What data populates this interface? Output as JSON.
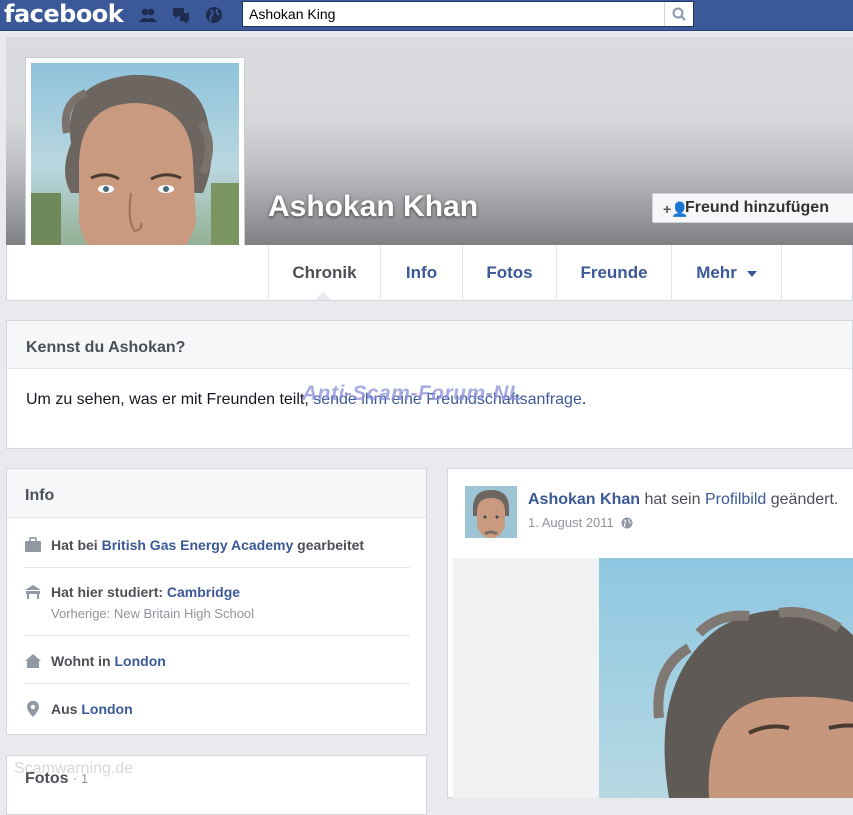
{
  "header": {
    "logo": "facebook",
    "search_value": "Ashokan King",
    "search_placeholder": ""
  },
  "profile": {
    "name": "Ashokan Khan",
    "add_friend_label": "Freund hinzufügen"
  },
  "tabs": [
    {
      "label": "Chronik"
    },
    {
      "label": "Info"
    },
    {
      "label": "Fotos"
    },
    {
      "label": "Freunde"
    },
    {
      "label": "Mehr"
    }
  ],
  "know_box": {
    "title": "Kennst du Ashokan?",
    "text_before": "Um zu sehen, was er mit Freunden teilt, ",
    "link": "sende ihm eine Freundschaftsanfrage",
    "text_after": "."
  },
  "watermark": "Anti-Scam-Forum-NL",
  "info": {
    "title": "Info",
    "work_prefix": "Hat bei ",
    "work_link": "British Gas Energy Academy",
    "work_suffix": " gearbeitet",
    "study_prefix": "Hat hier studiert: ",
    "study_link": "Cambridge",
    "study_previous": "Vorherige: New Britain High School",
    "lives_prefix": "Wohnt in ",
    "lives_link": "London",
    "from_prefix": "Aus ",
    "from_link": "London"
  },
  "fotos": {
    "title": "Fotos",
    "count": "· 1"
  },
  "footer_watermark": "Scamwarning.de",
  "post": {
    "author": "Ashokan Khan",
    "action_before": " hat sein ",
    "action_link": "Profilbild",
    "action_after": " geändert.",
    "date": "1. August 2011"
  },
  "colors": {
    "brand_blue": "#3b5998",
    "background": "#e9eaed"
  }
}
